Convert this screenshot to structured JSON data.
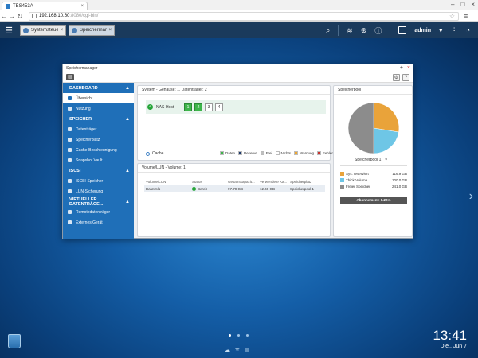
{
  "browser": {
    "tab_title": "TBS453A",
    "url_host": "192.168.10.60",
    "url_path": ":8080/cgi-bin/",
    "tab_close": "×",
    "minimize": "–",
    "maximize": "□",
    "close": "×"
  },
  "qts": {
    "app_tabs": [
      {
        "label": "Systemsteuerun...",
        "close": "×"
      },
      {
        "label": "Speichermanag...",
        "close": "×"
      }
    ],
    "username": "admin",
    "user_caret": "▾"
  },
  "window": {
    "title": "Speichermanager",
    "btn_min": "–",
    "btn_max": "+",
    "btn_close": "×"
  },
  "sidebar": {
    "sections": [
      {
        "label": "DASHBOARD",
        "items": [
          {
            "label": "Übersicht"
          },
          {
            "label": "Nutzung"
          }
        ]
      },
      {
        "label": "SPEICHER",
        "items": [
          {
            "label": "Datenträger"
          },
          {
            "label": "Speicherplatz"
          },
          {
            "label": "Cache-Beschleunigung"
          },
          {
            "label": "Snapshot Vault"
          }
        ]
      },
      {
        "label": "iSCSI",
        "items": [
          {
            "label": "iSCSI-Speicher"
          },
          {
            "label": "LUN-Sicherung"
          }
        ]
      },
      {
        "label": "VIRTUELLER DATENTRÄGE...",
        "items": [
          {
            "label": "Remotedatenträger"
          },
          {
            "label": "Externes Gerät"
          }
        ]
      }
    ],
    "chevron": "▲"
  },
  "system_panel": {
    "title": "System - Gehäuse: 1, Datenträger: 2",
    "host_label": "NAS-Host",
    "bays": [
      "1",
      "2",
      "3",
      "4"
    ],
    "cache_label": "Cache",
    "legend": [
      {
        "label": "Daten",
        "color": "#3db54a"
      },
      {
        "label": "Reserve",
        "color": "#1d3a6e"
      },
      {
        "label": "Frei",
        "color": "#bfbfbf"
      },
      {
        "label": "Nichts",
        "color": "#ffffff"
      },
      {
        "label": "Warnung",
        "color": "#f0a830"
      },
      {
        "label": "Fehler",
        "color": "#c8322d"
      }
    ]
  },
  "volume_panel": {
    "title": "Volume/LUN - Volume: 1",
    "columns": [
      "Volume/LUN",
      "Status",
      "Gesamtkapazit...",
      "Verwendete Ka...",
      "Speicherplatz"
    ],
    "rows": [
      {
        "name": "DataVol1",
        "status": "Bereit",
        "total": "97.79 GB",
        "used": "12.40 GB",
        "pool": "Speicherpool 1"
      }
    ]
  },
  "pool_panel": {
    "title": "Speicherpool",
    "selected_pool": "Speicherpool 1",
    "caret": "▾",
    "legend": [
      {
        "label": "Sys. reserviert",
        "value": "116.9 GB",
        "color": "#e9a33a"
      },
      {
        "label": "Thick-Volume",
        "value": "100.0 GB",
        "color": "#6ec6e6"
      },
      {
        "label": "Freier Speicher",
        "value": "241.0 GB",
        "color": "#8c8c8c"
      }
    ],
    "status": "Abonnement: 0.22:1"
  },
  "desktop": {
    "time": "13:41",
    "date": "Die., Jun 7"
  }
}
